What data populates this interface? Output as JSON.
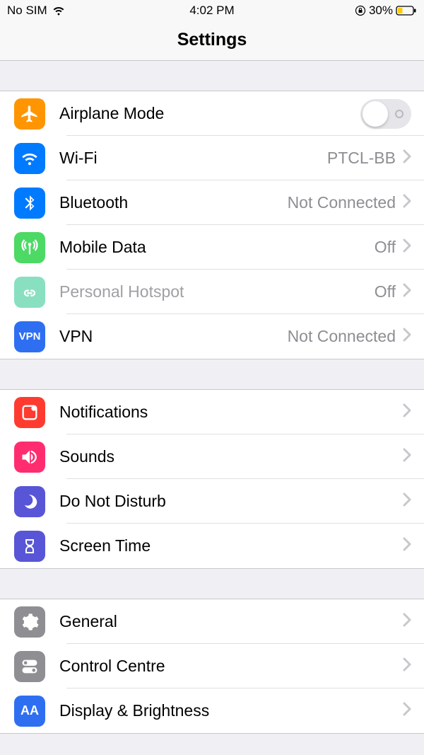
{
  "status_bar": {
    "carrier": "No SIM",
    "time": "4:02 PM",
    "battery_pct": "30%"
  },
  "header": {
    "title": "Settings"
  },
  "group1": {
    "airplane": {
      "label": "Airplane Mode"
    },
    "wifi": {
      "label": "Wi-Fi",
      "value": "PTCL-BB"
    },
    "bluetooth": {
      "label": "Bluetooth",
      "value": "Not Connected"
    },
    "mobiledata": {
      "label": "Mobile Data",
      "value": "Off"
    },
    "hotspot": {
      "label": "Personal Hotspot",
      "value": "Off"
    },
    "vpn": {
      "label": "VPN",
      "value": "Not Connected",
      "icon_text": "VPN"
    }
  },
  "group2": {
    "notifications": {
      "label": "Notifications"
    },
    "sounds": {
      "label": "Sounds"
    },
    "dnd": {
      "label": "Do Not Disturb"
    },
    "screentime": {
      "label": "Screen Time"
    }
  },
  "group3": {
    "general": {
      "label": "General"
    },
    "controlcentre": {
      "label": "Control Centre"
    },
    "display": {
      "label": "Display & Brightness",
      "icon_text": "AA"
    }
  }
}
